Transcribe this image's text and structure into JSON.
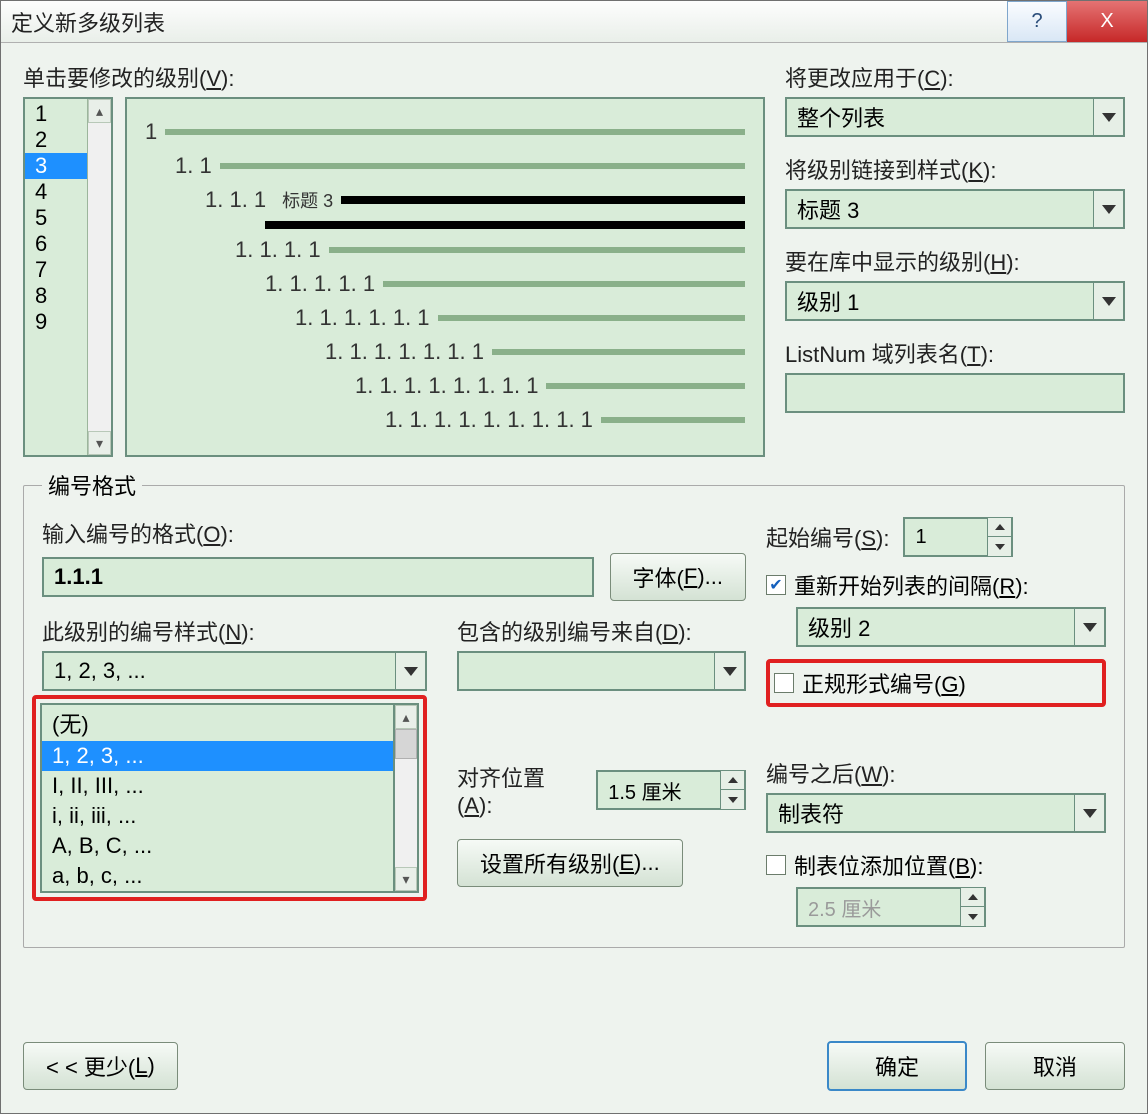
{
  "titlebar": {
    "title": "定义新多级列表",
    "help": "?",
    "close": "X"
  },
  "labels": {
    "click_level": "单击要修改的级别(",
    "click_level_u": "V",
    "click_level_end": "):",
    "apply_to": "将更改应用于(",
    "apply_to_u": "C",
    "apply_to_end": "):",
    "link_style": "将级别链接到样式(",
    "link_style_u": "K",
    "link_style_end": "):",
    "show_level": "要在库中显示的级别(",
    "show_level_u": "H",
    "show_level_end": "):",
    "listnum": "ListNum 域列表名(",
    "listnum_u": "T",
    "listnum_end": "):",
    "num_format_group": "编号格式",
    "enter_format": "输入编号的格式(",
    "enter_format_u": "O",
    "enter_format_end": "):",
    "font_btn": "字体(",
    "font_btn_u": "F",
    "font_btn_end": ")...",
    "num_style": "此级别的编号样式(",
    "num_style_u": "N",
    "num_style_end": "):",
    "include_from": "包含的级别编号来自(",
    "include_from_u": "D",
    "include_from_end": "):",
    "start_at": "起始编号(",
    "start_at_u": "S",
    "start_at_end": "):",
    "restart": "重新开始列表的间隔(",
    "restart_u": "R",
    "restart_end": "):",
    "legal": "正规形式编号(",
    "legal_u": "G",
    "legal_end": ")",
    "align_at": "对齐位置(",
    "align_at_u": "A",
    "align_at_end": "):",
    "set_all": "设置所有级别(",
    "set_all_u": "E",
    "set_all_end": ")...",
    "follow": "编号之后(",
    "follow_u": "W",
    "follow_end": "):",
    "tab_add": "制表位添加位置(",
    "tab_add_u": "B",
    "tab_add_end": "):",
    "less": "< < 更少(",
    "less_u": "L",
    "less_end": ")",
    "ok": "确定",
    "cancel": "取消"
  },
  "levels": {
    "items": [
      "1",
      "2",
      "3",
      "4",
      "5",
      "6",
      "7",
      "8",
      "9"
    ],
    "selected": "3"
  },
  "preview": {
    "rows": [
      {
        "indent": 0,
        "num": "1",
        "dark": false
      },
      {
        "indent": 1,
        "num": "1. 1",
        "dark": false
      },
      {
        "indent": 2,
        "num": "1. 1. 1",
        "label": "标题 3",
        "dark": true
      },
      {
        "indent": 2,
        "num": "",
        "label": "",
        "dark": true,
        "baronly": true
      },
      {
        "indent": 3,
        "num": "1. 1. 1. 1",
        "dark": false
      },
      {
        "indent": 4,
        "num": "1. 1. 1. 1. 1",
        "dark": false
      },
      {
        "indent": 5,
        "num": "1. 1. 1. 1. 1. 1",
        "dark": false
      },
      {
        "indent": 6,
        "num": "1. 1. 1. 1. 1. 1. 1",
        "dark": false
      },
      {
        "indent": 7,
        "num": "1. 1. 1. 1. 1. 1. 1. 1",
        "dark": false
      },
      {
        "indent": 8,
        "num": "1. 1. 1. 1. 1. 1. 1. 1. 1",
        "dark": false
      }
    ]
  },
  "combos": {
    "apply_to": "整个列表",
    "link_style": "标题 3",
    "show_level": "级别 1",
    "listnum": "",
    "number_format": "1.1.1",
    "num_style": "1, 2, 3, ...",
    "include_from": "",
    "restart_level": "级别 2",
    "align_at": "1.5 厘米",
    "follow": "制表符",
    "tab_pos": "2.5 厘米",
    "start_at": "1"
  },
  "num_style_options": [
    "(无)",
    "1, 2, 3, ...",
    "I, II, III, ...",
    "i, ii, iii, ...",
    "A, B, C, ...",
    "a, b, c, ..."
  ],
  "num_style_selected": "1, 2, 3, ...",
  "checks": {
    "restart": true,
    "legal": false,
    "tab_add": false
  }
}
